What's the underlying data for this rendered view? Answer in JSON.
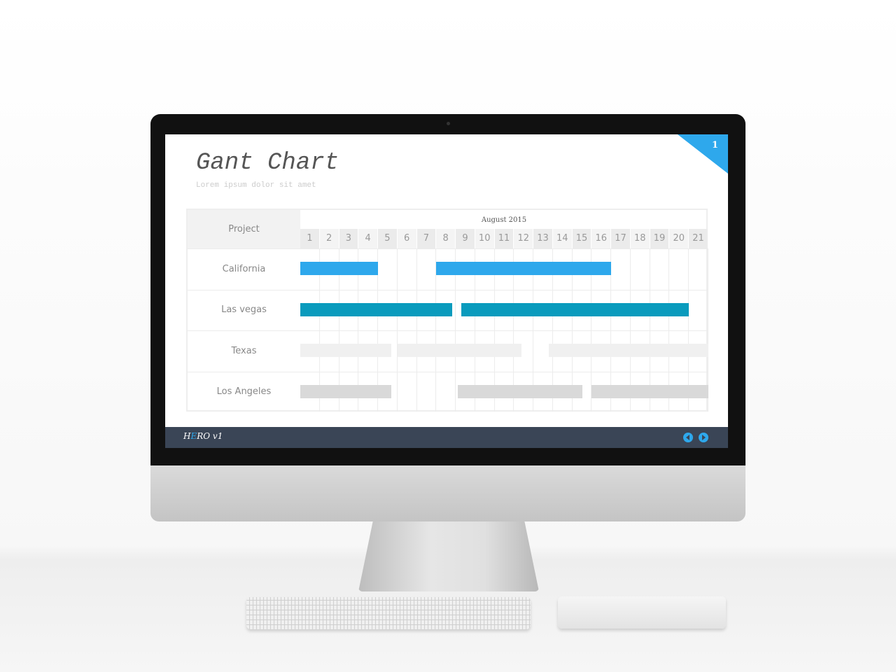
{
  "slide": {
    "title": "Gant Chart",
    "subtitle": "Lorem ipsum dolor sit amet",
    "page_number": "1",
    "accent_color": "#2ea8ec"
  },
  "footer": {
    "brand_h": "H",
    "brand_e": "E",
    "brand_rest": "RO v1",
    "prev_icon": "circle-left-arrow-icon",
    "next_icon": "circle-right-arrow-icon"
  },
  "chart_data": {
    "type": "gantt",
    "title": "Gant Chart",
    "row_header": "Project",
    "month_label": "August 2015",
    "days": [
      1,
      2,
      3,
      4,
      5,
      6,
      7,
      8,
      9,
      10,
      11,
      12,
      13,
      14,
      15,
      16,
      17,
      18,
      19,
      20,
      21
    ],
    "series": [
      {
        "name": "California",
        "color": "#2ea8ec",
        "tasks": [
          {
            "start": 1,
            "end": 4
          },
          {
            "start": 8,
            "end": 16
          }
        ]
      },
      {
        "name": "Las vegas",
        "color": "#0a9bbd",
        "tasks": [
          {
            "start": 1,
            "end": 7.8
          },
          {
            "start": 9.3,
            "end": 20
          }
        ]
      },
      {
        "name": "Texas",
        "color": "#f0f0f0",
        "tasks": [
          {
            "start": 1,
            "end": 4.7
          },
          {
            "start": 6,
            "end": 11.4
          },
          {
            "start": 13.8,
            "end": 21
          }
        ]
      },
      {
        "name": "Los Angeles",
        "color": "#d9d9d9",
        "tasks": [
          {
            "start": 1,
            "end": 4.7
          },
          {
            "start": 9.1,
            "end": 14.5
          },
          {
            "start": 16,
            "end": 21
          }
        ]
      }
    ]
  }
}
